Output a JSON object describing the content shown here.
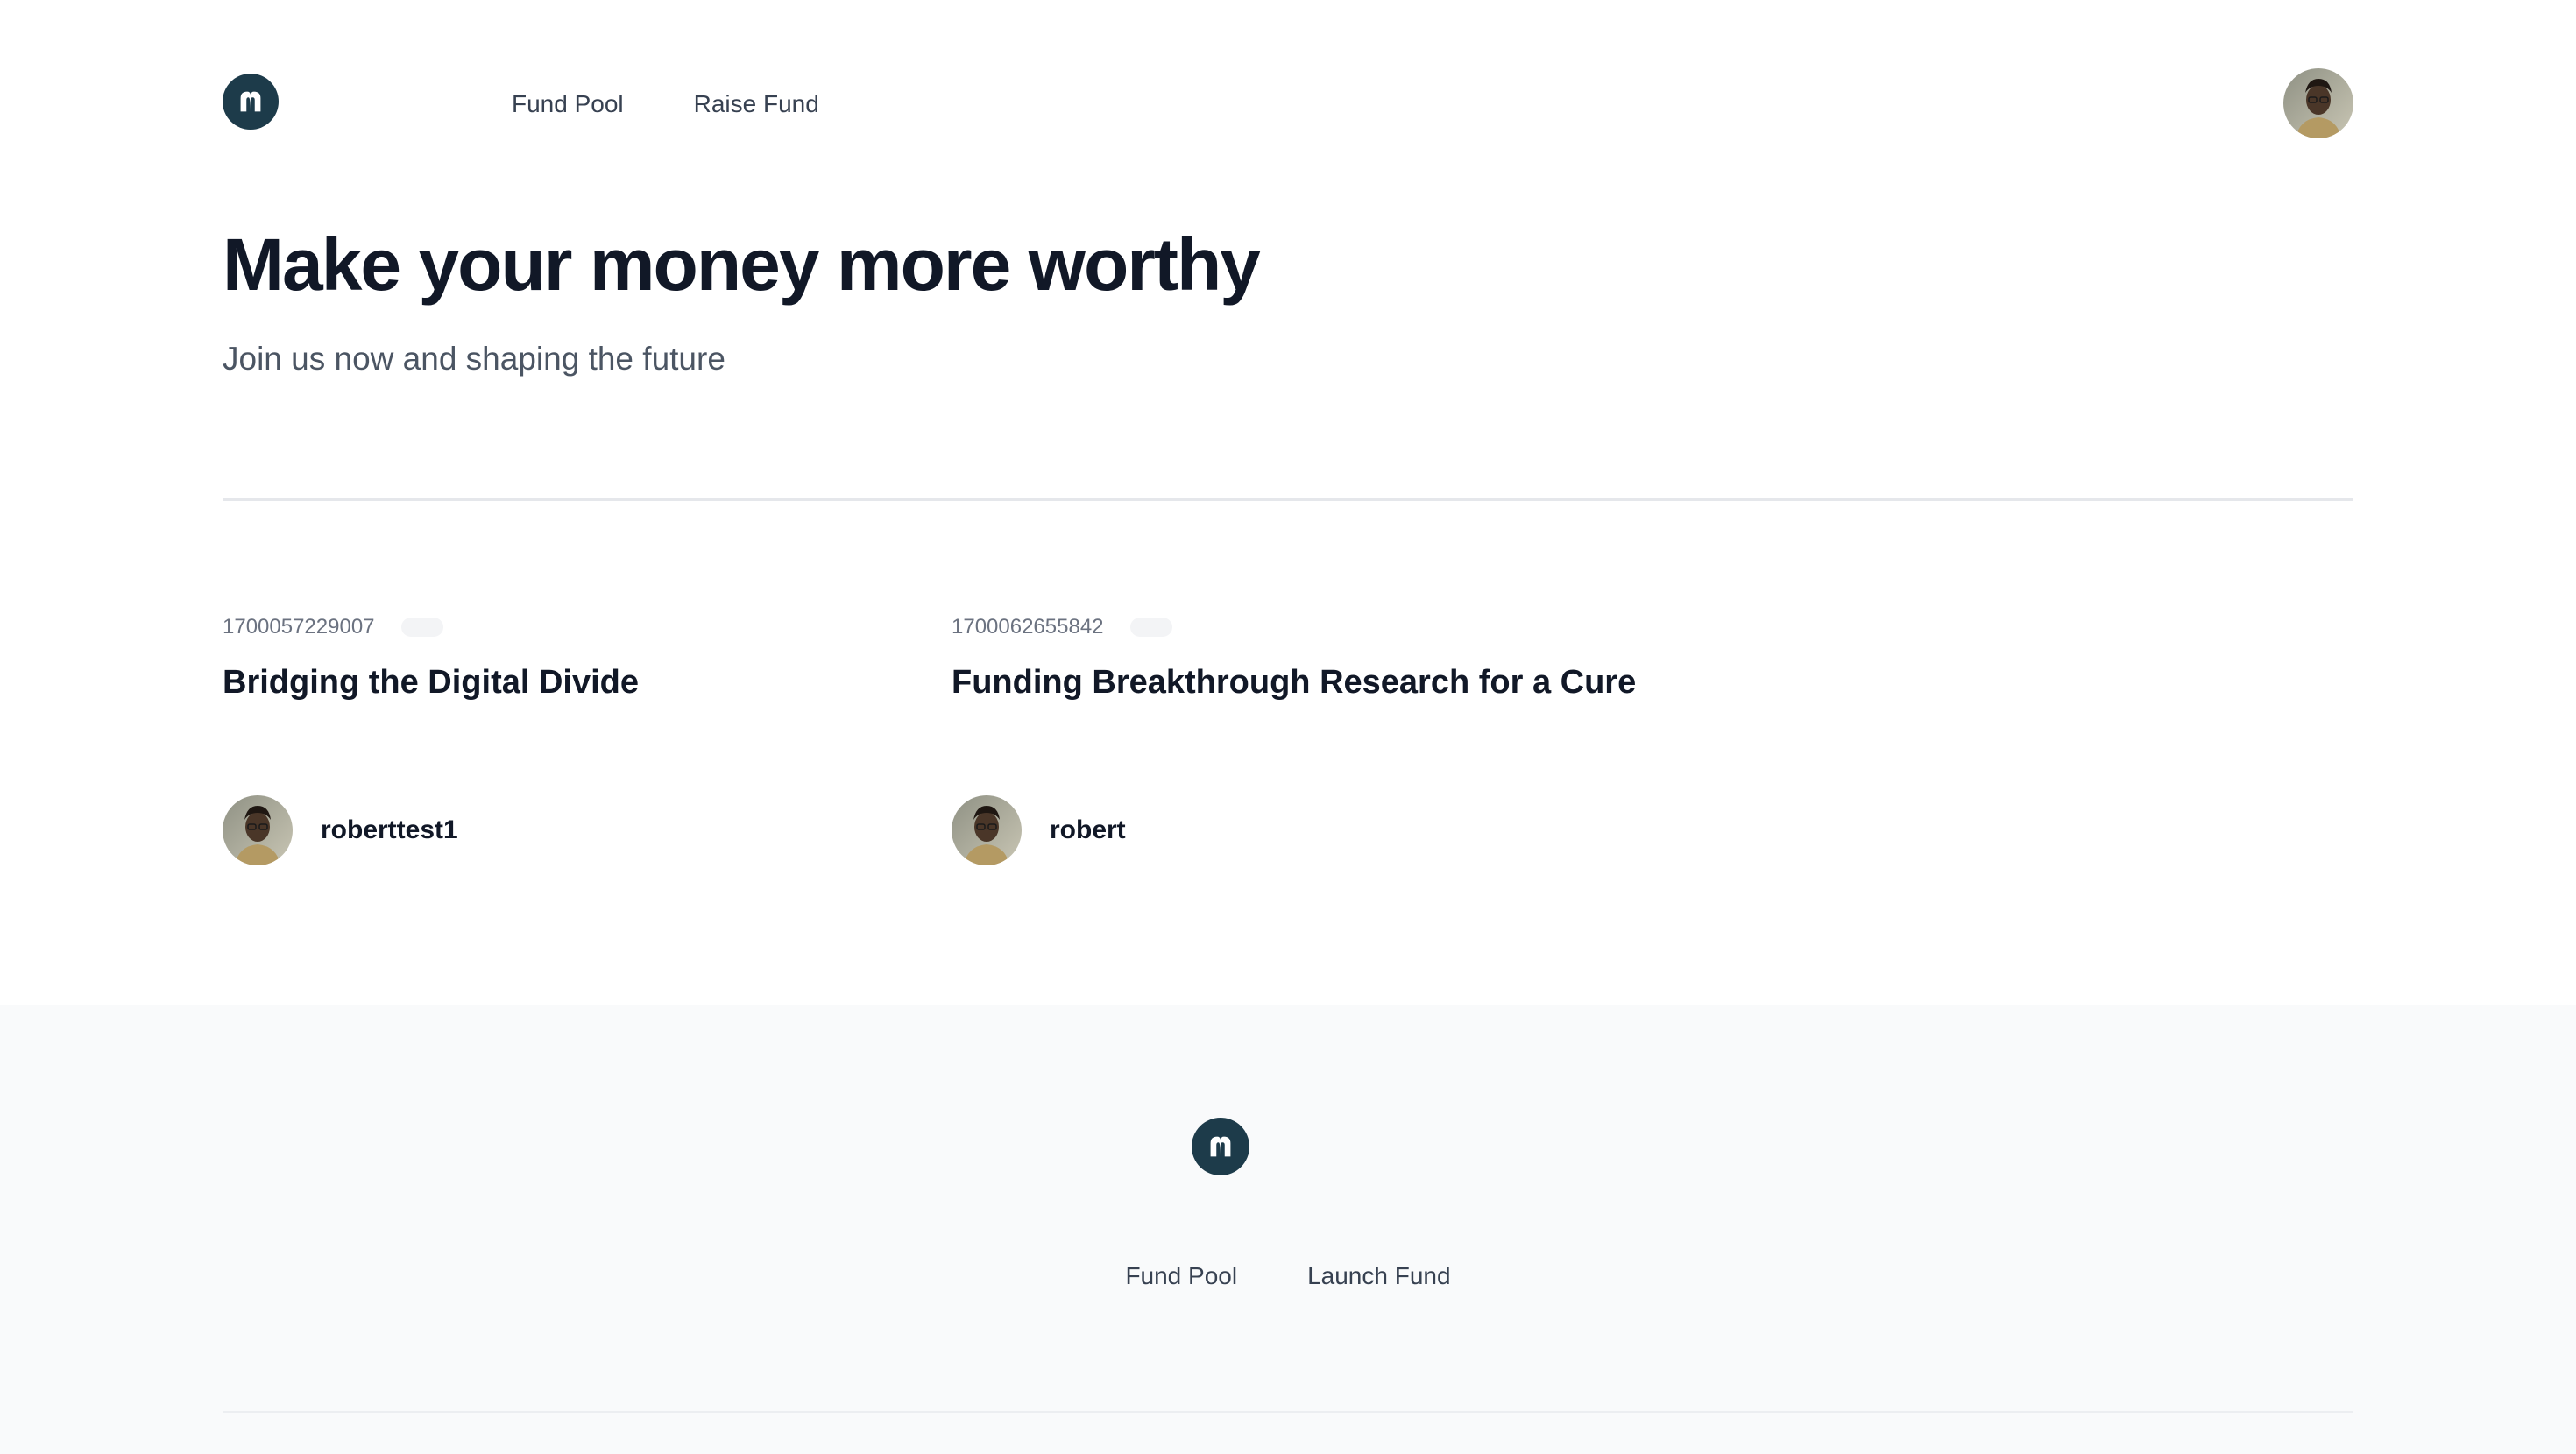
{
  "brand": {
    "logo_icon": "m-logo-icon",
    "color": "#1d3b4a"
  },
  "header": {
    "nav": [
      {
        "label": "Fund Pool"
      },
      {
        "label": "Raise Fund"
      }
    ],
    "avatar_icon": "user-avatar"
  },
  "hero": {
    "title": "Make your money more worthy",
    "subtitle": "Join us now and shaping the future"
  },
  "cards": [
    {
      "id": "1700057229007",
      "title": "Bridging the Digital Divide",
      "author": "roberttest1"
    },
    {
      "id": "1700062655842",
      "title": "Funding Breakthrough Research for a Cure",
      "author": "robert"
    }
  ],
  "footer": {
    "nav": [
      {
        "label": "Fund Pool"
      },
      {
        "label": "Launch Fund"
      }
    ]
  }
}
